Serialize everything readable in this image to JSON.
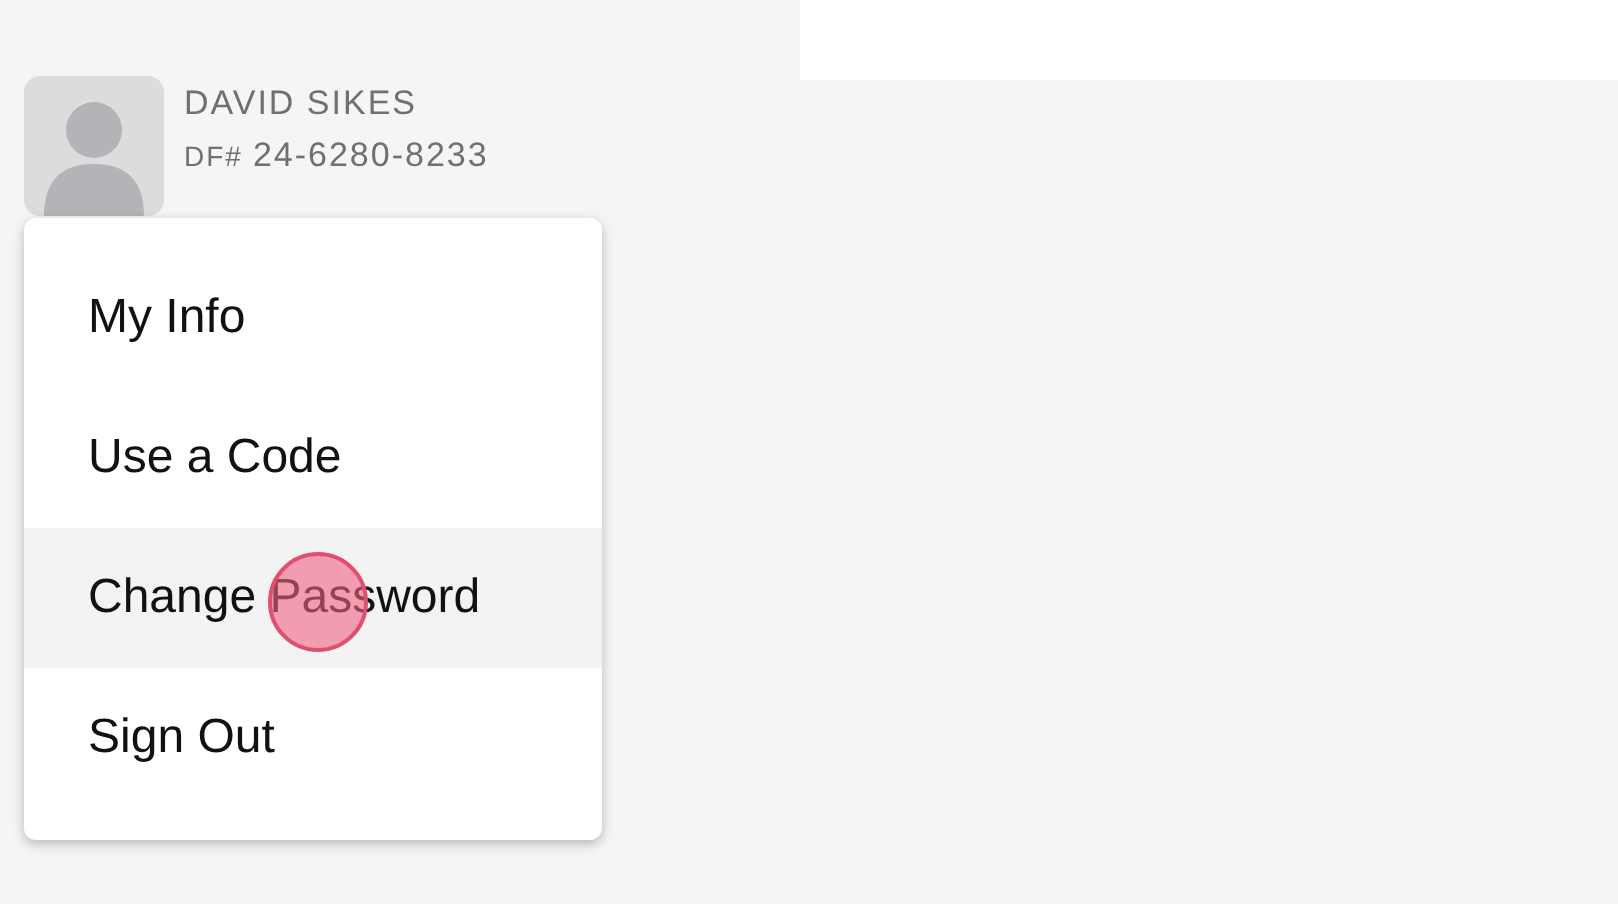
{
  "user": {
    "name": "DAVID SIKES",
    "id_label": "DF#",
    "id_value": "24-6280-8233"
  },
  "menu": {
    "items": [
      {
        "label": "My Info",
        "selected": false
      },
      {
        "label": "Use a Code",
        "selected": false
      },
      {
        "label": "Change Password",
        "selected": true
      },
      {
        "label": "Sign Out",
        "selected": false
      }
    ]
  }
}
